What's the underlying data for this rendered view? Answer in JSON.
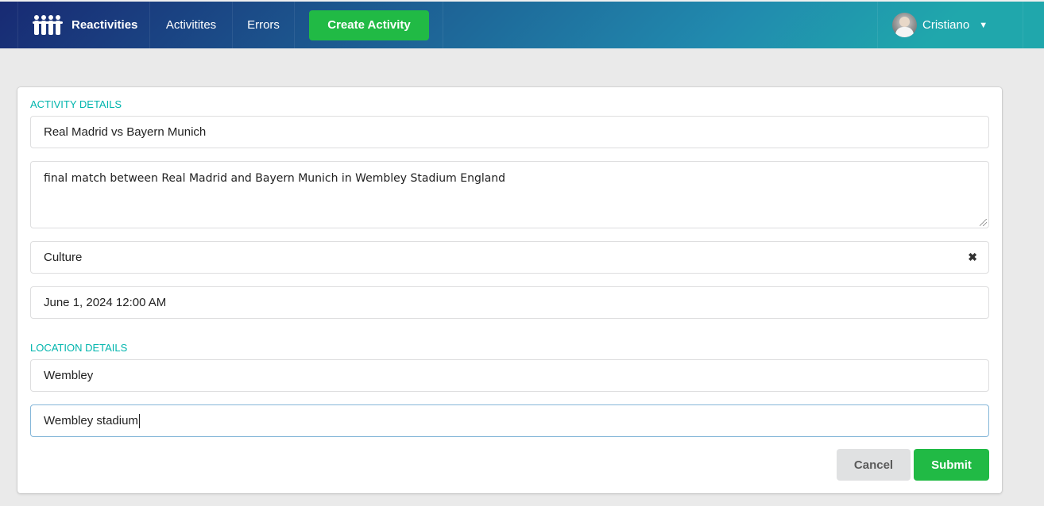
{
  "nav": {
    "brand": "Reactivities",
    "activities": "Activitites",
    "errors": "Errors",
    "create_activity": "Create Activity",
    "user_name": "Cristiano"
  },
  "form": {
    "activity_header": "ACTIVITY DETAILS",
    "title": "Real Madrid vs Bayern Munich",
    "description": "final match between Real Madrid and Bayern Munich in Wembley Stadium England",
    "category": "Culture",
    "date": "June 1, 2024 12:00 AM",
    "location_header": "LOCATION DETAILS",
    "city": "Wembley",
    "venue": "Wembley stadium",
    "cancel": "Cancel",
    "submit": "Submit"
  },
  "colors": {
    "accent_teal": "#00b5ad",
    "positive_green": "#21ba45",
    "nav_gradient_start": "#182a73",
    "nav_gradient_end": "#20a7ac"
  },
  "icons": {
    "brand": "group-icon",
    "clear": "close-icon",
    "dropdown": "caret-down-icon"
  }
}
